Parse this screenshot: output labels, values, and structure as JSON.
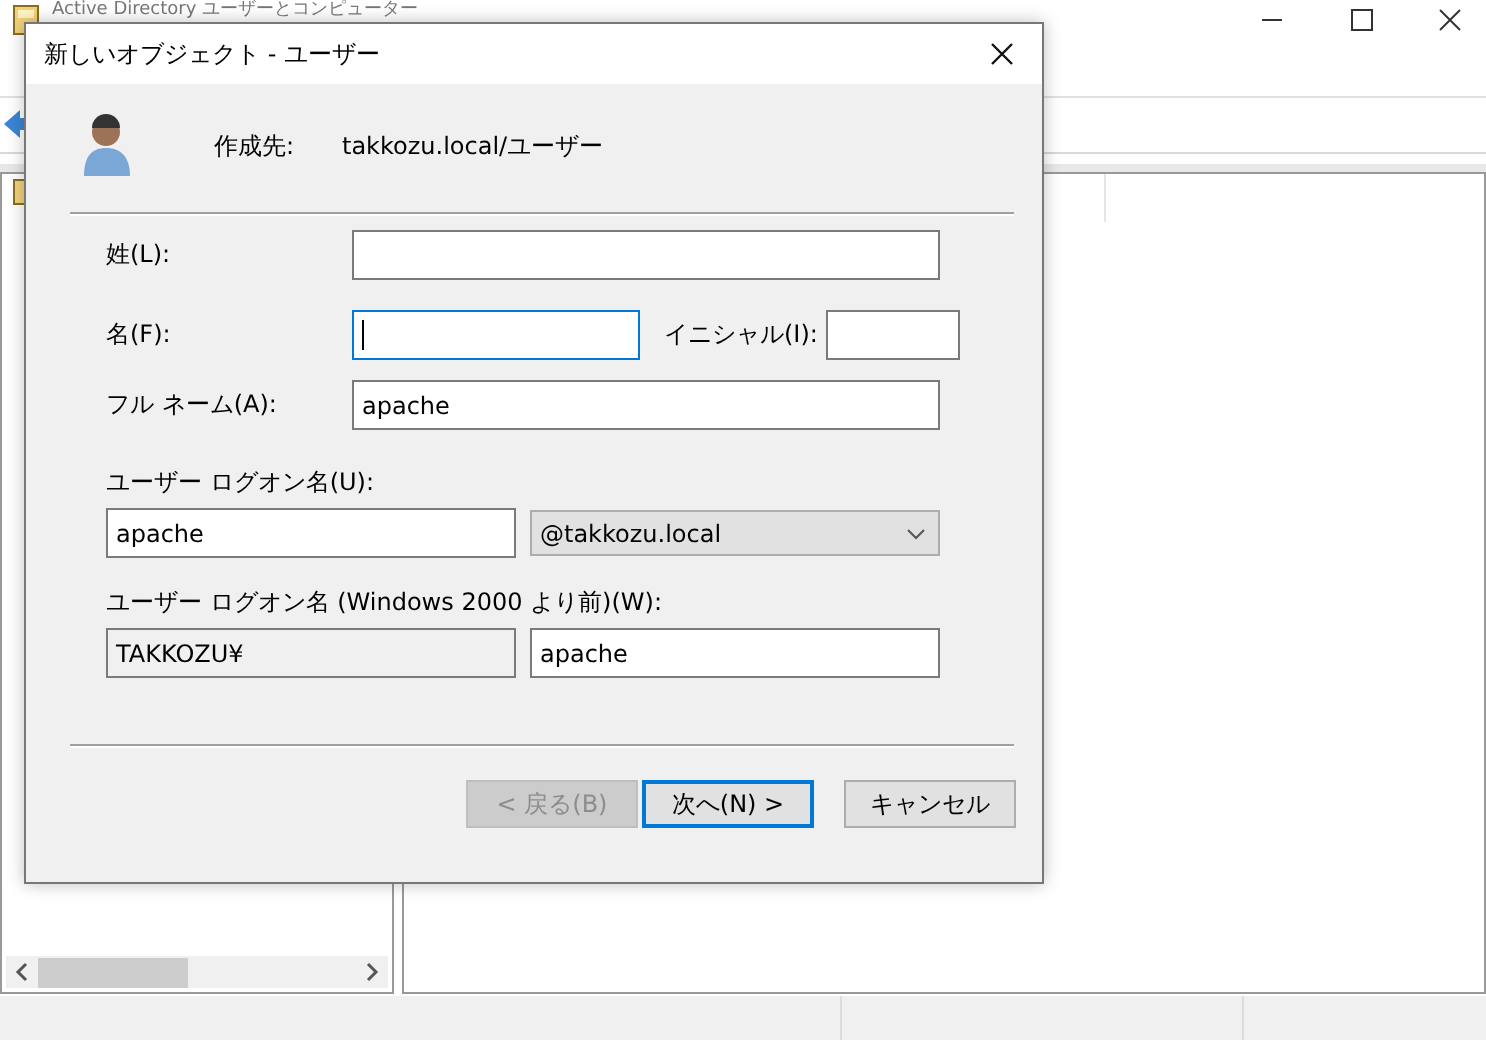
{
  "background_window": {
    "title": "Active Directory ユーザーとコンピューター"
  },
  "dialog": {
    "title": "新しいオブジェクト - ユーザー",
    "create_in_label": "作成先:",
    "create_in_value": "takkozu.local/ユーザー",
    "last_name": {
      "label": "姓(L):",
      "focused": false
    },
    "first_name": {
      "label": "名(F):",
      "focused": true
    },
    "initials": {
      "label": "イニシャル(I):",
      "focused": false
    },
    "full_name": {
      "label": "フル ネーム(A):",
      "value": "apache",
      "focused": false
    },
    "logon_name": {
      "label": "ユーザー ログオン名(U):",
      "value": "apache",
      "domain": "@takkozu.local",
      "focused": false
    },
    "pre2000_logon_name": {
      "label": "ユーザー ログオン名 (Windows 2000 より前)(W):",
      "domain": "TAKKOZU¥",
      "value": "apache",
      "focused": false
    },
    "buttons": [
      {
        "label": "< 戻る(B)",
        "disabled": true,
        "default": false
      },
      {
        "label": "次へ(N) >",
        "disabled": false,
        "default": true
      },
      {
        "label": "キャンセル",
        "disabled": false,
        "default": false
      }
    ]
  }
}
